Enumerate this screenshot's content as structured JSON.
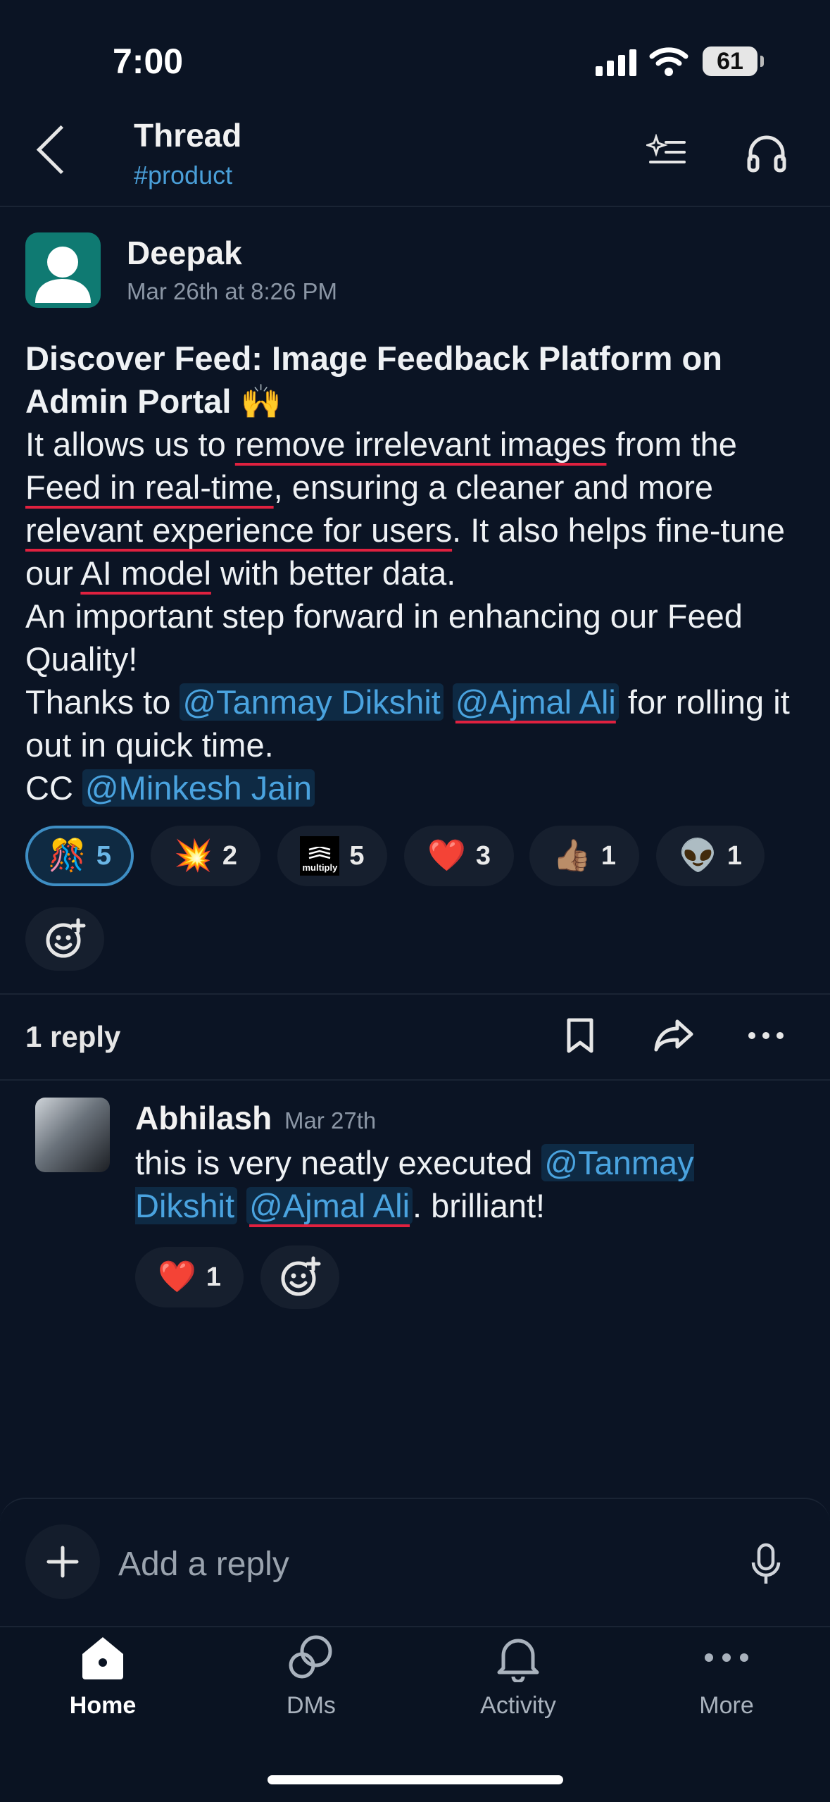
{
  "status_bar": {
    "time": "7:00",
    "battery": "61"
  },
  "header": {
    "title": "Thread",
    "channel": "#product"
  },
  "post": {
    "author": "Deepak",
    "timestamp": "Mar 26th at 8:26 PM",
    "title": "Discover Feed: Image Feedback Platform on Admin Portal",
    "title_emoji": "🙌",
    "p1_a": "It allows us to ",
    "p1_u1": "remove irrelevant images",
    "p1_b": " from the ",
    "p1_u2": "Feed in real-time",
    "p1_c": ", ensuring a cleaner and more ",
    "p1_u3": "relevant experience for users",
    "p1_d": ". It also helps fine-tune our ",
    "p1_u4": "AI model",
    "p1_e": " with better data.",
    "p2": "An important step forward in enhancing our Feed Quality!",
    "p3_a": "Thanks to ",
    "mention1": "@Tanmay Dikshit",
    "mention2": "@Ajmal Ali",
    "p3_b": " for rolling it out in quick time.",
    "p4_a": "CC ",
    "mention3": "@Minkesh Jain",
    "reactions": [
      {
        "emoji": "🎊",
        "count": "5",
        "selected": true
      },
      {
        "emoji": "💥",
        "count": "2"
      },
      {
        "emoji": "multiply",
        "count": "5"
      },
      {
        "emoji": "❤️",
        "count": "3"
      },
      {
        "emoji": "👍🏽",
        "count": "1"
      },
      {
        "emoji": "👽",
        "count": "1"
      }
    ]
  },
  "thread": {
    "reply_count": "1 reply"
  },
  "reply": {
    "author": "Abhilash",
    "timestamp": "Mar 27th",
    "text_a": "this is very neatly executed ",
    "mention1": "@Tanmay Dikshit",
    "mention2": "@Ajmal Ali",
    "text_b": ". brilliant!",
    "reactions": [
      {
        "emoji": "❤️",
        "count": "1"
      }
    ]
  },
  "composer": {
    "placeholder": "Add a reply"
  },
  "tabs": [
    {
      "label": "Home",
      "icon": "home-icon",
      "active": true
    },
    {
      "label": "DMs",
      "icon": "dms-icon"
    },
    {
      "label": "Activity",
      "icon": "bell-icon"
    },
    {
      "label": "More",
      "icon": "more-icon"
    }
  ]
}
